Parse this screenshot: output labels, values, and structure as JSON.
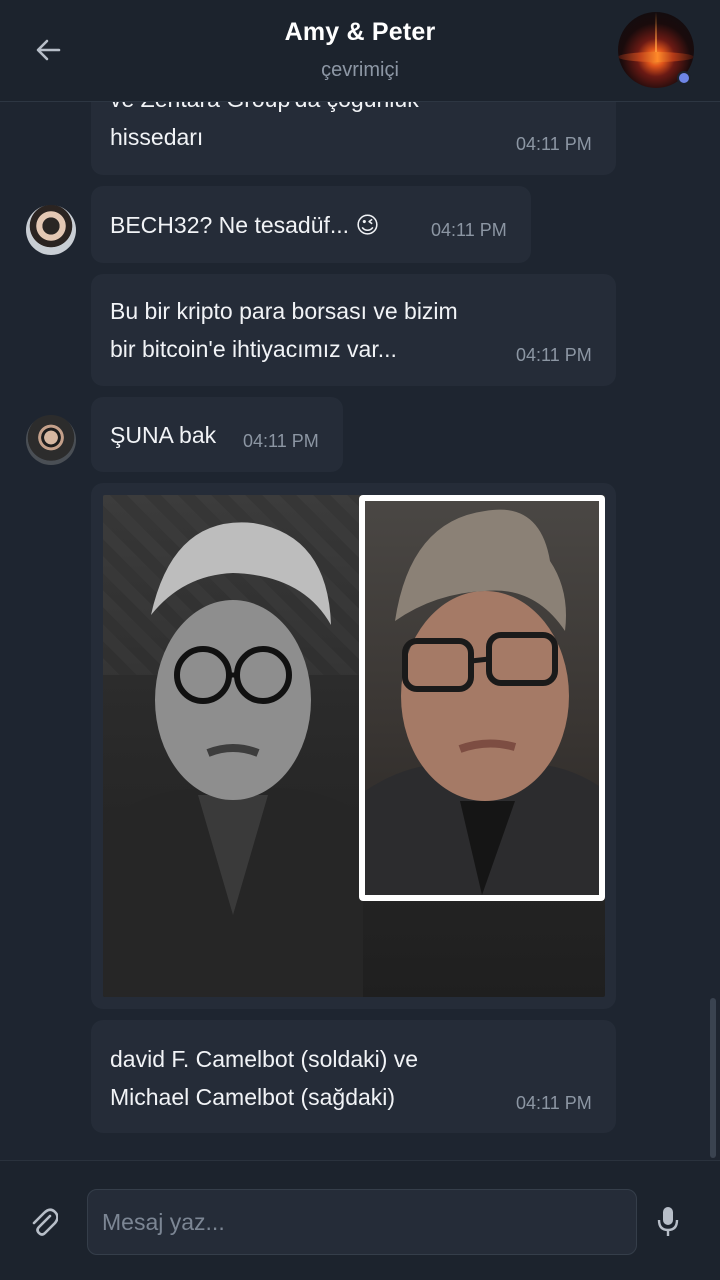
{
  "header": {
    "title": "Amy & Peter",
    "status": "çevrimiçi",
    "back_icon": "arrow-left-icon",
    "avatar_icon": "group-avatar"
  },
  "messages": [
    {
      "sender": "Peter",
      "text": "ve Zentara Group'da çoğunluk\nhissedarı",
      "time": "04:11 PM"
    },
    {
      "sender": "Amy",
      "text": "BECH32? Ne tesadüf... 😉",
      "time": "04:11 PM"
    },
    {
      "sender": "Amy",
      "text": "Bu bir kripto para borsası ve bizim\nbir bitcoin'e ihtiyacımız var...",
      "time": "04:11 PM"
    },
    {
      "sender": "Peter",
      "text": "ŞUNA bak",
      "time": "04:11 PM"
    },
    {
      "sender": "Peter",
      "type": "image"
    },
    {
      "sender": "Peter",
      "text": "david F. Camelbot (soldaki) ve\nMichael Camelbot (sağdaki)",
      "time": "04:11 PM"
    }
  ],
  "input": {
    "placeholder": "Mesaj yaz...",
    "value": ""
  },
  "colors": {
    "background": "#1e2530",
    "bubble": "#252c38",
    "header": "#1c232d",
    "online_dot": "#6f86e6",
    "time_text": "#8c96a3"
  }
}
